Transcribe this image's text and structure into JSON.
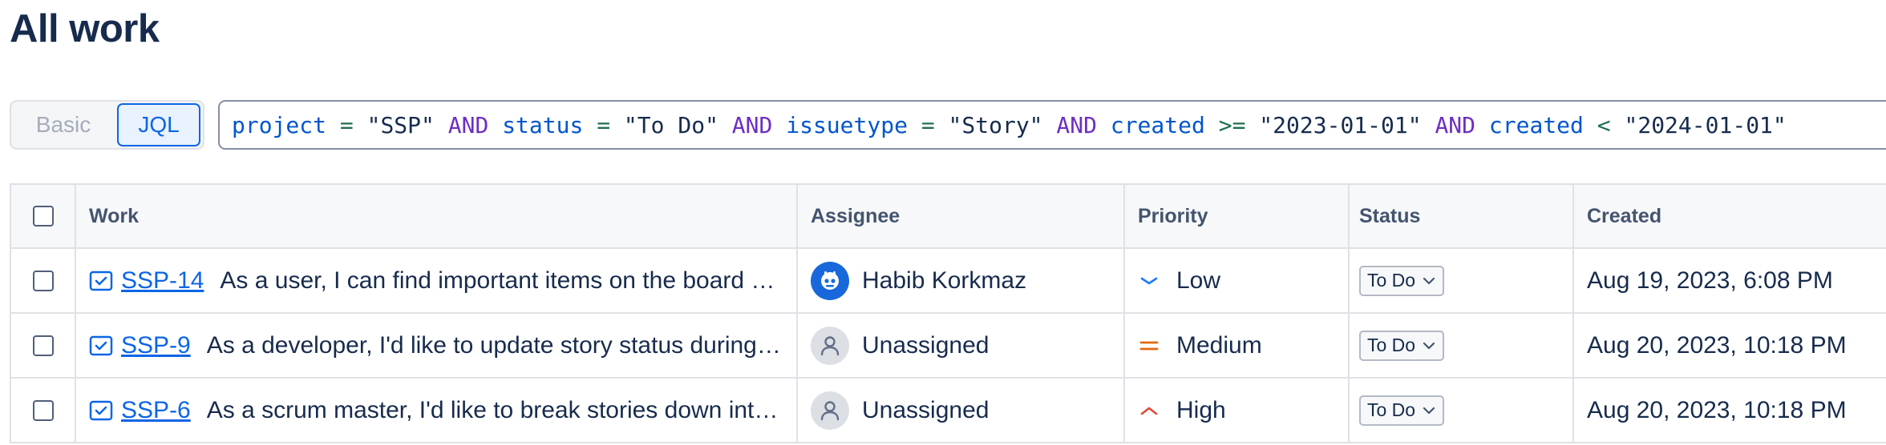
{
  "page": {
    "title": "All work"
  },
  "search_mode": {
    "basic_label": "Basic",
    "jql_label": "JQL",
    "selected": "JQL"
  },
  "jql": {
    "query": "project = \"SSP\" AND status = \"To Do\" AND issuetype = \"Story\" AND created >= \"2023-01-01\" AND created < \"2024-01-01\"",
    "tokens": [
      {
        "t": "project",
        "k": "field"
      },
      {
        "t": " "
      },
      {
        "t": "=",
        "k": "op"
      },
      {
        "t": " "
      },
      {
        "t": "\"SSP\"",
        "k": "str"
      },
      {
        "t": " "
      },
      {
        "t": "AND",
        "k": "kw"
      },
      {
        "t": " "
      },
      {
        "t": "status",
        "k": "field"
      },
      {
        "t": " "
      },
      {
        "t": "=",
        "k": "op"
      },
      {
        "t": " "
      },
      {
        "t": "\"To Do\"",
        "k": "str"
      },
      {
        "t": " "
      },
      {
        "t": "AND",
        "k": "kw"
      },
      {
        "t": " "
      },
      {
        "t": "issuetype",
        "k": "field"
      },
      {
        "t": " "
      },
      {
        "t": "=",
        "k": "op"
      },
      {
        "t": " "
      },
      {
        "t": "\"Story\"",
        "k": "str"
      },
      {
        "t": " "
      },
      {
        "t": "AND",
        "k": "kw"
      },
      {
        "t": " "
      },
      {
        "t": "created",
        "k": "field"
      },
      {
        "t": " "
      },
      {
        "t": ">=",
        "k": "op"
      },
      {
        "t": " "
      },
      {
        "t": "\"2023-01-01\"",
        "k": "str"
      },
      {
        "t": " "
      },
      {
        "t": "AND",
        "k": "kw"
      },
      {
        "t": " "
      },
      {
        "t": "created",
        "k": "field"
      },
      {
        "t": " "
      },
      {
        "t": "<",
        "k": "op"
      },
      {
        "t": " "
      },
      {
        "t": "\"2024-01-01\"",
        "k": "str"
      }
    ]
  },
  "table": {
    "headers": {
      "work": "Work",
      "assignee": "Assignee",
      "priority": "Priority",
      "status": "Status",
      "created": "Created"
    },
    "rows": [
      {
        "key": "SSP-14",
        "type_icon": "story-icon",
        "summary": "As a user, I can find important items on the board by using the customisable \"Quick Filters\" above >> Try clicking the \"Only My Issues\" Quick Filter above",
        "assignee": "Habib Korkmaz",
        "avatar": "user-avatar",
        "priority": "Low",
        "priority_icon": "priority-low-icon",
        "status": "To Do",
        "created": "Aug 19, 2023, 6:08 PM"
      },
      {
        "key": "SSP-9",
        "type_icon": "story-icon",
        "summary": "As a developer, I'd like to update story status during the sprint >> Click the Active sprints link at the top right of the screen to go to the Active sprints where the current Sprint's items can be updated",
        "assignee": "Unassigned",
        "avatar": "unassigned-avatar",
        "priority": "Medium",
        "priority_icon": "priority-medium-icon",
        "status": "To Do",
        "created": "Aug 20, 2023, 10:18 PM"
      },
      {
        "key": "SSP-6",
        "type_icon": "story-icon",
        "summary": "As a scrum master, I'd like to break stories down into tasks we can track during the sprint >> Try creating a task by clicking the Sub-Tasks tab in the Detail View on the right",
        "assignee": "Unassigned",
        "avatar": "unassigned-avatar",
        "priority": "High",
        "priority_icon": "priority-high-icon",
        "status": "To Do",
        "created": "Aug 20, 2023, 10:18 PM"
      }
    ]
  },
  "colors": {
    "link": "#0c66e4",
    "priority_low": "#1d7afc",
    "priority_medium": "#e56910",
    "priority_high": "#e34935",
    "jql_field": "#0055cc",
    "jql_keyword": "#6e2ec2",
    "jql_operator": "#216e4e"
  }
}
